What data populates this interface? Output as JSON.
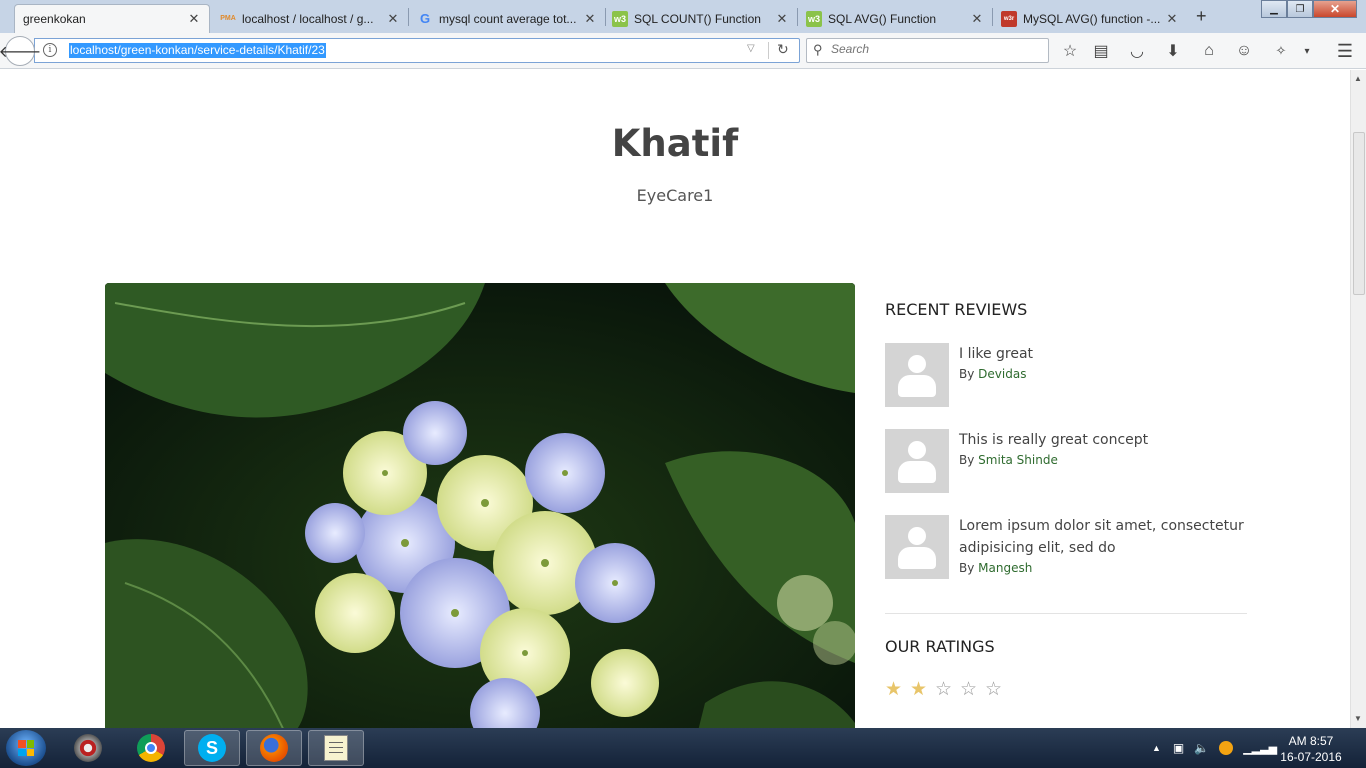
{
  "browser": {
    "tabs": [
      {
        "label": "greenkokan",
        "favicon": "",
        "active": true
      },
      {
        "label": "localhost / localhost / g...",
        "favicon": "PMA",
        "active": false
      },
      {
        "label": "mysql count average tot...",
        "favicon": "G",
        "active": false
      },
      {
        "label": "SQL COUNT() Function",
        "favicon": "w3",
        "active": false
      },
      {
        "label": "SQL AVG() Function",
        "favicon": "w3",
        "active": false
      },
      {
        "label": "MySQL AVG() function -...",
        "favicon": "w3r",
        "active": false
      }
    ],
    "url": "localhost/green-konkan/service-details/Khatif/23",
    "search_placeholder": "Search"
  },
  "page": {
    "title": "Khatif",
    "subtitle": "EyeCare1",
    "sidebar": {
      "recent_reviews_heading": "RECENT REVIEWS",
      "reviews": [
        {
          "message": "I like great",
          "by_label": "By",
          "author": "Devidas"
        },
        {
          "message": "This is really great concept",
          "by_label": "By",
          "author": "Smita Shinde"
        },
        {
          "message": "Lorem ipsum dolor sit amet, consectetur adipisicing elit, sed do",
          "by_label": "By",
          "author": "Mangesh"
        }
      ],
      "ratings_heading": "OUR RATINGS",
      "rating": 2,
      "rating_max": 5
    }
  },
  "taskbar": {
    "time": "AM 8:57",
    "date": "16-07-2016"
  }
}
